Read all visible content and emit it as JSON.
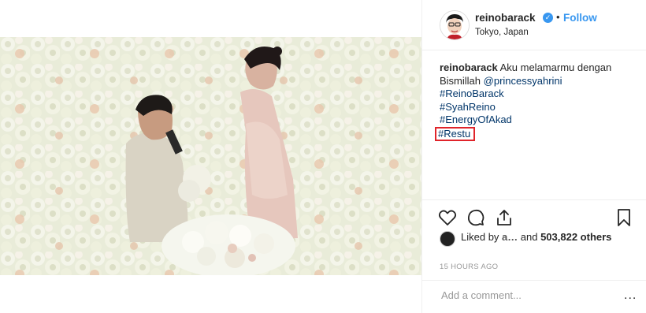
{
  "post": {
    "username": "reinobarack",
    "verified_icon": "verified-badge-icon",
    "separator": "•",
    "follow_label": "Follow",
    "location": "Tokyo, Japan",
    "caption": {
      "user": "reinobarack",
      "text_before": "Aku melamarmu dengan Bismillah",
      "mention": "@princessyahrini",
      "hashtags": [
        "#ReinoBarack",
        "#SyahReino",
        "#EnergyOfAkad"
      ],
      "highlighted_hashtag": "#Restu"
    },
    "likes": {
      "prefix": "Liked by",
      "liker": "a...",
      "connector": "and",
      "count_text": "503,822 others"
    },
    "timestamp": "15 HOURS AGO",
    "comment": {
      "placeholder": "Add a comment...",
      "more_label": "..."
    }
  },
  "colors": {
    "accent": "#3897f0",
    "link": "#003569",
    "highlight_box": "#e0242a",
    "muted": "#999999"
  }
}
